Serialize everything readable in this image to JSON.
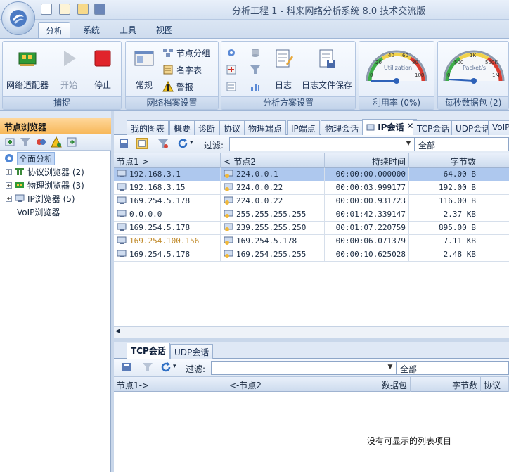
{
  "window": {
    "title": "分析工程 1 - 科来网络分析系统 8.0 技术交流版"
  },
  "ribbon_tabs": [
    {
      "label": "分析",
      "active": true
    },
    {
      "label": "系统",
      "active": false
    },
    {
      "label": "工具",
      "active": false
    },
    {
      "label": "视图",
      "active": false
    }
  ],
  "ribbon": {
    "capture": {
      "label": "捕捉",
      "adapter": "网络适配器",
      "start": "开始",
      "stop": "停止"
    },
    "profile": {
      "label": "网络档案设置",
      "normal": "常规",
      "node_group": "节点分组",
      "dictionary": "名字表",
      "alarm": "警报"
    },
    "scheme": {
      "label": "分析方案设置",
      "log": "日志",
      "log_save": "日志文件保存"
    },
    "utilization": {
      "label": "利用率 (0%)",
      "gauge_title": "Utilization",
      "value_percent": 0,
      "ticks": [
        "0",
        "20",
        "40",
        "60",
        "80",
        "100"
      ]
    },
    "packets": {
      "label": "每秒数据包 (2)",
      "gauge_title": "Packet/s",
      "value": 2,
      "ticks": [
        "0",
        "500",
        "1K",
        "500K",
        "1M"
      ]
    }
  },
  "left_panel": {
    "title": "节点浏览器",
    "tree": [
      {
        "label": "全面分析",
        "selected": true
      },
      {
        "label": "协议浏览器 (2)"
      },
      {
        "label": "物理浏览器 (3)"
      },
      {
        "label": "IP浏览器 (5)"
      },
      {
        "label": "VoIP浏览器"
      }
    ]
  },
  "doc_tabs": [
    "我的图表",
    "概要",
    "诊断",
    "协议",
    "物理端点",
    "IP端点",
    "物理会话",
    "IP会话",
    "TCP会话",
    "UDP会话",
    "VoIP"
  ],
  "active_doc_tab": "IP会话",
  "upper": {
    "filter_label": "过滤:",
    "filter_value": "",
    "scope": "全部",
    "columns": [
      "节点1->",
      "<-节点2",
      "持续时间",
      "字节数"
    ],
    "rows": [
      {
        "node1": "192.168.3.1",
        "node2": "224.0.0.1",
        "duration": "00:00:00.000000",
        "bytes": "64.00 B",
        "selected": true
      },
      {
        "node1": "192.168.3.15",
        "node2": "224.0.0.22",
        "duration": "00:00:03.999177",
        "bytes": "192.00 B"
      },
      {
        "node1": "169.254.5.178",
        "node2": "224.0.0.22",
        "duration": "00:00:00.931723",
        "bytes": "116.00 B"
      },
      {
        "node1": "0.0.0.0",
        "node2": "255.255.255.255",
        "duration": "00:01:42.339147",
        "bytes": "2.37 KB"
      },
      {
        "node1": "169.254.5.178",
        "node2": "239.255.255.250",
        "duration": "00:01:07.220759",
        "bytes": "895.00 B"
      },
      {
        "node1": "169.254.100.156",
        "node2": "169.254.5.178",
        "duration": "00:00:06.071379",
        "bytes": "7.11 KB",
        "highlight": "#c08a2a"
      },
      {
        "node1": "169.254.5.178",
        "node2": "169.254.255.255",
        "duration": "00:00:10.625028",
        "bytes": "2.48 KB"
      }
    ]
  },
  "lower": {
    "tabs": [
      {
        "label": "TCP会话",
        "active": true
      },
      {
        "label": "UDP会话",
        "active": false
      }
    ],
    "filter_label": "过滤:",
    "scope": "全部",
    "columns": [
      "节点1->",
      "<-节点2",
      "数据包",
      "字节数",
      "协议"
    ],
    "empty_message": "没有可显示的列表项目"
  },
  "colors": {
    "accent": "#f7b85a",
    "selection": "#aec8ee",
    "ribbon_border": "#9fb6d6"
  }
}
